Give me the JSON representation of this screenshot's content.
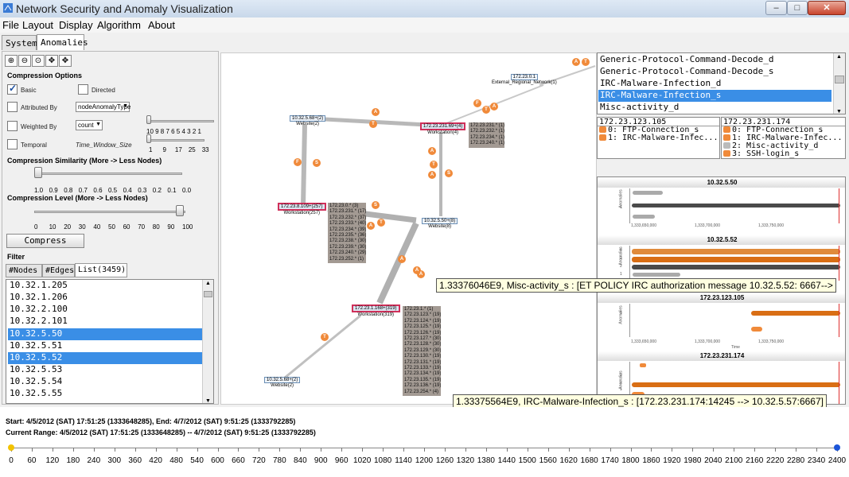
{
  "window": {
    "title": "Network Security and Anomaly Visualization"
  },
  "menu": [
    "File",
    "Layout",
    "Display",
    "Algorithm",
    "About"
  ],
  "tabs": [
    "System",
    "Anomalies"
  ],
  "left": {
    "compression_options": "Compression Options",
    "basic": "Basic",
    "directed": "Directed",
    "attributed_by": "Attributed By",
    "attributed_value": "nodeAnomalyType",
    "weighted_by": "Weighted By",
    "weighted_value": "count",
    "temporal": "Temporal",
    "time_window": "Time_Window_Size",
    "weighted_ticks": "10 9 8 7 6 5 4 3 2 1",
    "temporal_ticks": [
      "1",
      "9",
      "17",
      "25",
      "33"
    ],
    "similarity_label": "Compression Similarity (More -> Less Nodes)",
    "similarity_ticks": [
      "1.0",
      "0.9",
      "0.8",
      "0.7",
      "0.6",
      "0.5",
      "0.4",
      "0.3",
      "0.2",
      "0.1",
      "0.0"
    ],
    "level_label": "Compression Level (More -> Less Nodes)",
    "level_ticks": [
      "0",
      "10",
      "20",
      "30",
      "40",
      "50",
      "60",
      "70",
      "80",
      "90",
      "100"
    ],
    "compress_button": "Compress",
    "filter_label": "Filter",
    "filter_tabs": [
      "#Nodes",
      "#Edges",
      "List(3459)"
    ],
    "list_items": [
      "10.32.1.205",
      "10.32.1.206",
      "10.32.2.100",
      "10.32.2.101",
      "10.32.5.50",
      "10.32.5.51",
      "10.32.5.52",
      "10.32.5.53",
      "10.32.5.54",
      "10.32.5.55"
    ]
  },
  "graph": {
    "nodes": [
      {
        "label": "172.23.0.1",
        "sub": "External_Regional_Network(1)"
      },
      {
        "label": "10.32.5.68+(2)",
        "sub": "Website(2)"
      },
      {
        "label": "172.23.231.69+(4)",
        "sub": "Workstation(4)"
      },
      {
        "label": "172.23.8.109+(257)",
        "sub": "Workstation(257)"
      },
      {
        "label": "10.32.5.50+(8)",
        "sub": "Website(8)"
      },
      {
        "label": "172.23.1.168+(319)",
        "sub": "Workstation(319)"
      },
      {
        "label": "10.32.5.68+(2)",
        "sub": "Website(2)"
      }
    ],
    "ipbox1": "172.23.231.* (1)\n172.23.232.* (1)\n172.23.234.* (1)\n172.23.240.* (1)",
    "ipbox2": "172.23.0.* (3)\n172.23.231.* (17)\n172.23.232.* (37)\n172.23.233.* (40)\n172.23.234.* (39)\n172.23.235.* (36)\n172.23.238.* (30)\n172.23.239.* (30)\n172.23.240.* (29)\n172.23.252.* (1)",
    "ipbox3": "172.23.1.* (1)\n172.23.123.* (19)\n172.23.124.* (19)\n172.23.125.* (19)\n172.23.126.* (19)\n172.23.127.* (30)\n172.23.128.* (30)\n172.23.129.* (30)\n172.23.130.* (19)\n172.23.131.* (19)\n172.23.133.* (19)\n172.23.134.* (19)\n172.23.135.* (19)\n172.23.136.* (19)\n172.23.254.* (4)",
    "badge_letters": [
      "A",
      "T",
      "T",
      "A",
      "F",
      "A",
      "T",
      "F",
      "S",
      "A",
      "T",
      "A",
      "S",
      "S",
      "T",
      "A",
      "A",
      "A",
      "A",
      "T"
    ]
  },
  "alerts": {
    "items": [
      "Generic-Protocol-Command-Decode_d",
      "Generic-Protocol-Command-Decode_s",
      "IRC-Malware-Infection_d",
      "IRC-Malware-Infection_s",
      "Misc-activity_d"
    ],
    "table1_header": "172.23.123.105",
    "table1_rows": [
      "0: FTP-Connection_s",
      "1: IRC-Malware-Infec..."
    ],
    "table2_header": "172.23.231.174",
    "table2_rows": [
      "0: FTP-Connection_s",
      "1: IRC-Malware-Infec...",
      "2: Misc-activity_d",
      "3: SSH-login_s"
    ]
  },
  "timelines": [
    {
      "title": "10.32.5.50",
      "axis": [
        "1,333,650,000",
        "1,333,700,000",
        "1,333,750,000"
      ]
    },
    {
      "title": "10.32.5.52",
      "axis": []
    },
    {
      "title": "172.23.123.105",
      "axis": [
        "1,333,650,000",
        "1,333,700,000",
        "1,333,750,000"
      ],
      "xlabel": "Time"
    },
    {
      "title": "172.23.231.174",
      "axis": []
    }
  ],
  "tl_ylabel": "Anomalies",
  "tl_ynums": {
    "a": [
      "1"
    ],
    "b": [
      "4",
      "3",
      "2",
      "1"
    ],
    "c": [
      "1"
    ],
    "d": [
      "3",
      "2",
      "1"
    ]
  },
  "tooltip1": "1.33376046E9, Misc-activity_s : [ET POLICY IRC authorization message 10.32.5.52: 6667-->",
  "tooltip2": "1.33375564E9, IRC-Malware-Infection_s : [172.23.231.174:14245 --> 10.32.5.57:6667]",
  "bottom": {
    "start_line": "Start: 4/5/2012 (SAT) 17:51:25 (1333648285), End: 4/7/2012 (SAT) 9:51:25 (1333792285)",
    "range_line": "Current Range: 4/5/2012 (SAT) 17:51:25 (1333648285) -- 4/7/2012 (SAT) 9:51:25 (1333792285)",
    "ticks": [
      "0",
      "60",
      "120",
      "180",
      "240",
      "300",
      "360",
      "420",
      "480",
      "540",
      "600",
      "660",
      "720",
      "780",
      "840",
      "900",
      "960",
      "1020",
      "1080",
      "1140",
      "1200",
      "1260",
      "1320",
      "1380",
      "1440",
      "1500",
      "1560",
      "1620",
      "1680",
      "1740",
      "1800",
      "1860",
      "1920",
      "1980",
      "2040",
      "2100",
      "2160",
      "2220",
      "2280",
      "2340",
      "2400"
    ],
    "range_start": 0,
    "range_end": 2400,
    "colors": {
      "start": "#f2c200",
      "end": "#1c55d8"
    }
  }
}
